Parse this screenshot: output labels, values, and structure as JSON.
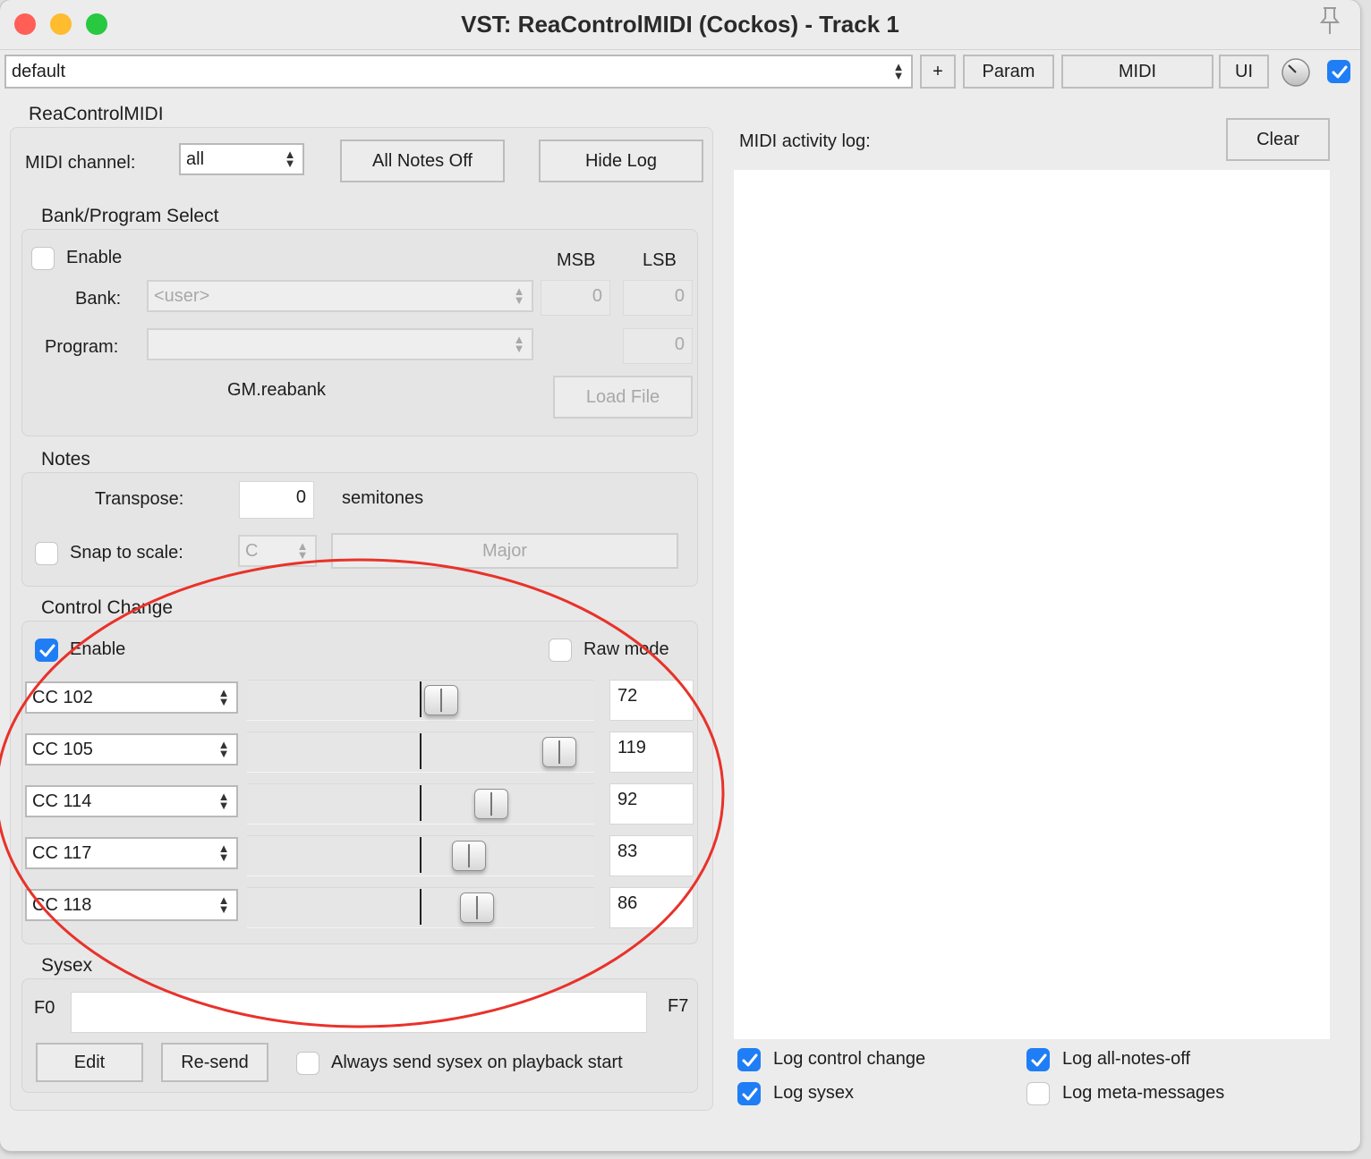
{
  "window": {
    "title": "VST: ReaControlMIDI (Cockos) - Track 1"
  },
  "toolbar": {
    "preset": "default",
    "plus_label": "+",
    "param_label": "Param",
    "midi_label": "MIDI",
    "ui_label": "UI",
    "enabled_checked": true
  },
  "plugin": {
    "name": "ReaControlMIDI",
    "midi_channel_label": "MIDI channel:",
    "midi_channel_value": "all",
    "all_notes_off_label": "All Notes Off",
    "hide_log_label": "Hide Log"
  },
  "bank_program": {
    "section_title": "Bank/Program Select",
    "enable_label": "Enable",
    "enable_checked": false,
    "msb_label": "MSB",
    "lsb_label": "LSB",
    "bank_label": "Bank:",
    "bank_value": "<user>",
    "bank_msb": "0",
    "bank_lsb": "0",
    "program_label": "Program:",
    "program_value": "",
    "program_num": "0",
    "file_name": "GM.reabank",
    "load_file_label": "Load File"
  },
  "notes": {
    "section_title": "Notes",
    "transpose_label": "Transpose:",
    "transpose_value": "0",
    "semitones_label": "semitones",
    "snap_label": "Snap to scale:",
    "snap_checked": false,
    "key_value": "C",
    "scale_value": "Major"
  },
  "control_change": {
    "section_title": "Control Change",
    "enable_label": "Enable",
    "enable_checked": true,
    "raw_mode_label": "Raw mode",
    "raw_mode_checked": false,
    "slider_max": 127,
    "rows": [
      {
        "cc": "CC 102",
        "value": "72"
      },
      {
        "cc": "CC 105",
        "value": "119"
      },
      {
        "cc": "CC 114",
        "value": "92"
      },
      {
        "cc": "CC 117",
        "value": "83"
      },
      {
        "cc": "CC 118",
        "value": "86"
      }
    ]
  },
  "sysex": {
    "section_title": "Sysex",
    "f0_label": "F0",
    "f7_label": "F7",
    "value": "",
    "edit_label": "Edit",
    "resend_label": "Re-send",
    "always_send_label": "Always send sysex on playback start",
    "always_send_checked": false
  },
  "log": {
    "title": "MIDI activity log:",
    "clear_label": "Clear",
    "options": [
      {
        "label": "Log control change",
        "checked": true
      },
      {
        "label": "Log all-notes-off",
        "checked": true
      },
      {
        "label": "Log sysex",
        "checked": true
      },
      {
        "label": "Log meta-messages",
        "checked": false
      }
    ]
  },
  "colors": {
    "accent": "#1f7ef5",
    "annotation": "#e8322a",
    "close": "#ff5f57",
    "minimize": "#febc2e",
    "zoom": "#28c840"
  }
}
